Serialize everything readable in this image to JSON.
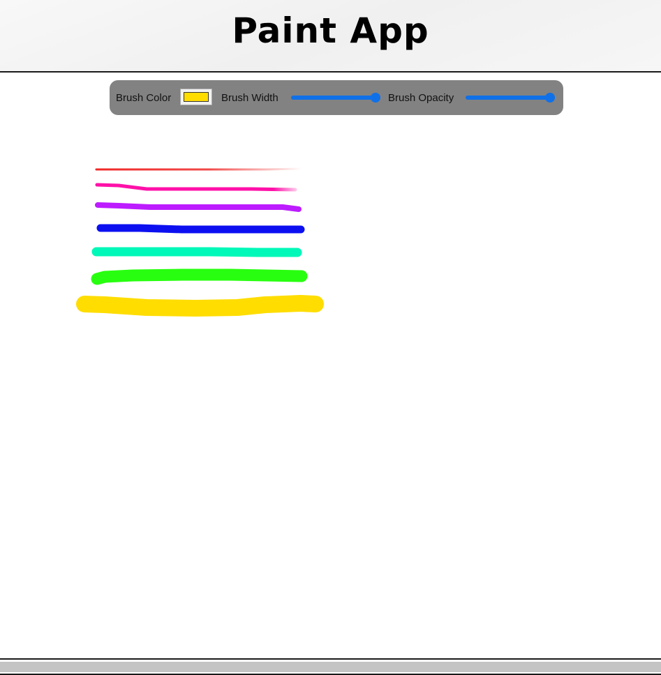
{
  "app": {
    "title": "Paint App"
  },
  "toolbar": {
    "brush_color_label": "Brush Color",
    "brush_color_value": "#ffdd00",
    "brush_width_label": "Brush Width",
    "brush_width_fraction": 1.0,
    "brush_opacity_label": "Brush Opacity",
    "brush_opacity_fraction": 1.0
  },
  "colors": {
    "toolbar_background": "#828282",
    "slider_accent": "#1070e8"
  },
  "strokes": [
    {
      "color": "#f02828",
      "fades_out": true
    },
    {
      "color": "#ff10a8",
      "fades_out": true
    },
    {
      "color": "#b810ff",
      "fades_out": false
    },
    {
      "color": "#0c10f0",
      "fades_out": false
    },
    {
      "color": "#00f8b8",
      "fades_out": false
    },
    {
      "color": "#28ff10",
      "fades_out": false
    },
    {
      "color": "#ffdd00",
      "fades_out": false
    }
  ]
}
